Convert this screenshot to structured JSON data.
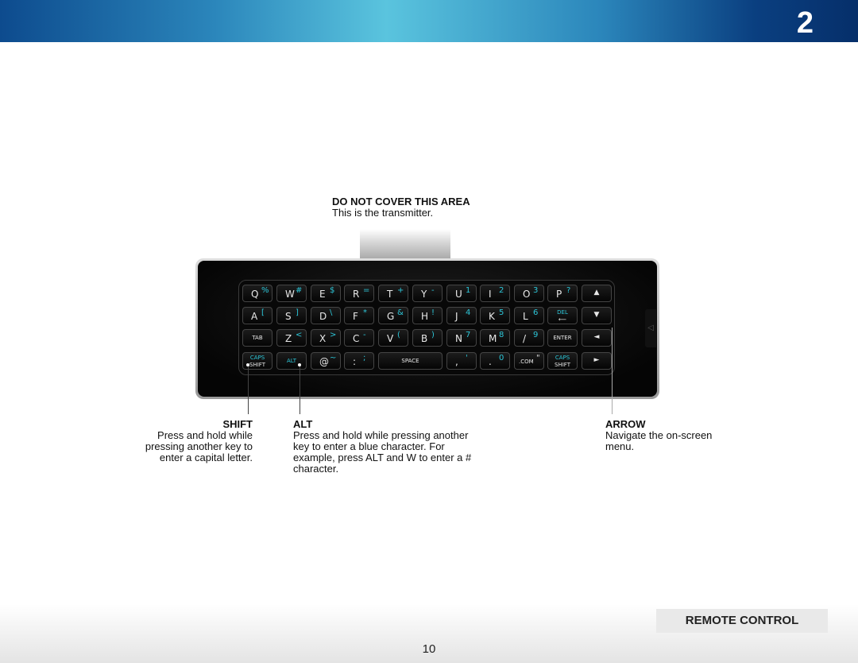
{
  "header": {
    "chapter_number": "2"
  },
  "transmitter": {
    "title": "DO NOT COVER THIS AREA",
    "subtitle": "This is the transmitter."
  },
  "keyboard": {
    "rows": [
      [
        {
          "m": "Q",
          "a": "%"
        },
        {
          "m": "W",
          "a": "#"
        },
        {
          "m": "E",
          "a": "$"
        },
        {
          "m": "R",
          "a": "="
        },
        {
          "m": "T",
          "a": "+"
        },
        {
          "m": "Y",
          "a": "-"
        },
        {
          "m": "U",
          "a": "1"
        },
        {
          "m": "I",
          "a": "2"
        },
        {
          "m": "O",
          "a": "3"
        },
        {
          "m": "P",
          "a": "?"
        },
        {
          "ar": "▲"
        }
      ],
      [
        {
          "m": "A",
          "a": "["
        },
        {
          "m": "S",
          "a": "]"
        },
        {
          "m": "D",
          "a": "\\"
        },
        {
          "m": "F",
          "a": "*"
        },
        {
          "m": "G",
          "a": "&"
        },
        {
          "m": "H",
          "a": "!"
        },
        {
          "m": "J",
          "a": "4"
        },
        {
          "m": "K",
          "a": "5"
        },
        {
          "m": "L",
          "a": "6"
        },
        {
          "c1": "DEL",
          "c2": "⟵",
          "blue1": true
        },
        {
          "ar": "▼"
        }
      ],
      [
        {
          "s": "TAB"
        },
        {
          "m": "Z",
          "a": "<"
        },
        {
          "m": "X",
          "a": ">"
        },
        {
          "m": "C",
          "a": "-"
        },
        {
          "m": "V",
          "a": "("
        },
        {
          "m": "B",
          "a": ")"
        },
        {
          "m": "N",
          "a": "7"
        },
        {
          "m": "M",
          "a": "8"
        },
        {
          "m": "/",
          "a": "9"
        },
        {
          "s": "ENTER"
        },
        {
          "ar": "◄"
        }
      ],
      [
        {
          "c1": "CAPS",
          "c2": "SHIFT",
          "blue1": true
        },
        {
          "s": "ALT",
          "blue": true
        },
        {
          "m": "@",
          "a": "~"
        },
        {
          "m": ":",
          "a": ";"
        },
        {
          "s": "SPACE",
          "wide": true
        },
        null,
        {
          "m": ",",
          "a": "'"
        },
        {
          "m": ".",
          "a": "0"
        },
        {
          "m": ".COM",
          "a": "\"",
          "small": true
        },
        {
          "c1": "CAPS",
          "c2": "SHIFT",
          "blue1": true
        },
        {
          "ar": "►"
        }
      ]
    ]
  },
  "callouts": {
    "shift": {
      "title": "SHIFT",
      "text": "Press and hold while pressing another key to enter a capital letter."
    },
    "alt": {
      "title": "ALT",
      "text": "Press and hold while pressing another key to enter a blue character. For example, press ALT and W to enter a # character."
    },
    "arrow": {
      "title": "ARROW",
      "text": "Navigate the on-screen menu."
    }
  },
  "footer": {
    "section": "REMOTE CONTROL",
    "page": "10"
  },
  "colors": {
    "alt_char": "#2cc6d8",
    "header_dark": "#062f6a",
    "header_light": "#5ac4de"
  }
}
